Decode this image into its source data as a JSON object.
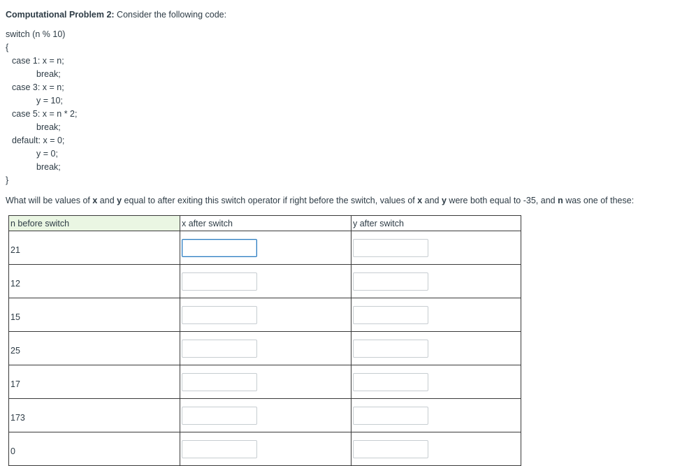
{
  "heading": {
    "bold": "Computational Problem 2:",
    "rest": " Consider the following code:"
  },
  "code": [
    "switch (n % 10)",
    "{",
    "case 1: x = n;",
    "break;",
    "case 3: x = n;",
    "y = 10;",
    "case 5: x = n * 2;",
    "break;",
    "default: x = 0;",
    "y = 0;",
    "break;",
    "}"
  ],
  "question": {
    "part1": "What will be values of ",
    "x": "x",
    "part2": " and ",
    "y": "y",
    "part3": " equal to after exiting this switch operator if right before the switch, values of ",
    "x2": "x",
    "part4": " and ",
    "y2": "y",
    "part5": " were both equal to -35, and ",
    "n": "n",
    "part6": " was one of these:"
  },
  "table": {
    "headers": [
      "n before switch",
      "x after switch",
      "y after switch"
    ],
    "rows": [
      {
        "n": "21",
        "x": "",
        "y": ""
      },
      {
        "n": "12",
        "x": "",
        "y": ""
      },
      {
        "n": "15",
        "x": "",
        "y": ""
      },
      {
        "n": "25",
        "x": "",
        "y": ""
      },
      {
        "n": "17",
        "x": "",
        "y": ""
      },
      {
        "n": "173",
        "x": "",
        "y": ""
      },
      {
        "n": "0",
        "x": "",
        "y": ""
      }
    ]
  }
}
